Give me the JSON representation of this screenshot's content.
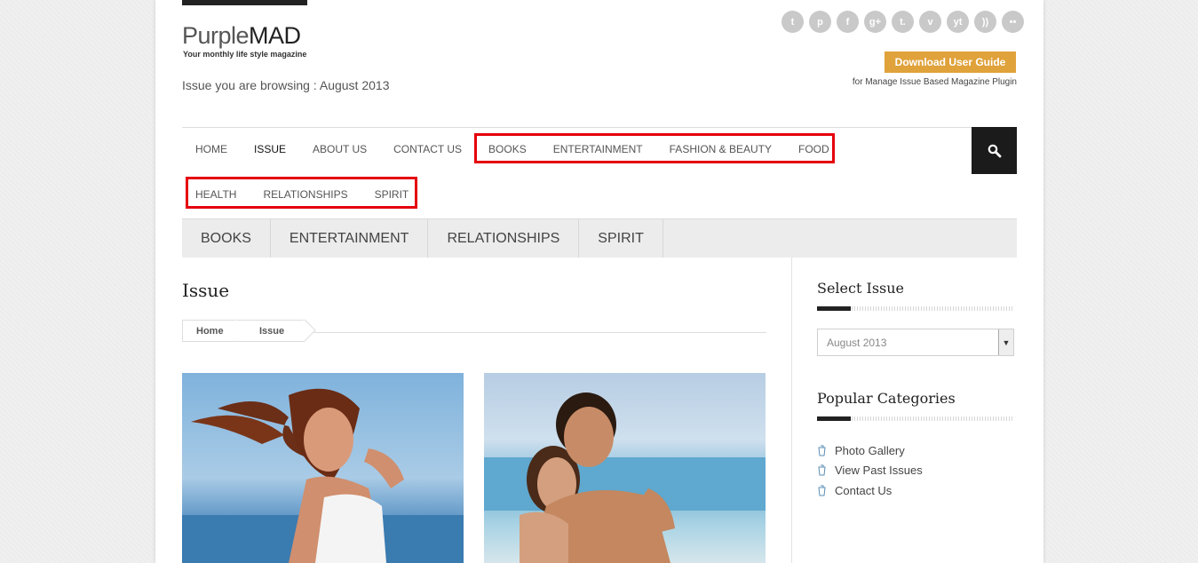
{
  "header": {
    "logo_part1": "Purple",
    "logo_part2": "MAD",
    "tagline": "Your monthly life style magazine",
    "issue_browsing": "Issue you are browsing : August 2013",
    "guide_button": "Download User Guide",
    "guide_note": "for Manage Issue Based Magazine Plugin",
    "social": [
      {
        "icon": "twitter-icon",
        "glyph": "t"
      },
      {
        "icon": "pinterest-icon",
        "glyph": "p"
      },
      {
        "icon": "facebook-icon",
        "glyph": "f"
      },
      {
        "icon": "googleplus-icon",
        "glyph": "g+"
      },
      {
        "icon": "tumblr-icon",
        "glyph": "t."
      },
      {
        "icon": "vimeo-icon",
        "glyph": "v"
      },
      {
        "icon": "youtube-icon",
        "glyph": "yt"
      },
      {
        "icon": "rss-icon",
        "glyph": "))"
      },
      {
        "icon": "flickr-icon",
        "glyph": "••"
      }
    ]
  },
  "nav": {
    "row1": [
      "HOME",
      "ISSUE",
      "ABOUT US",
      "CONTACT US",
      "BOOKS",
      "ENTERTAINMENT",
      "FASHION & BEAUTY",
      "FOOD"
    ],
    "row2": [
      "HEALTH",
      "RELATIONSHIPS",
      "SPIRIT"
    ],
    "active": "ISSUE",
    "search_icon": "search-icon",
    "highlight_color": "#e5000b"
  },
  "category_bar": [
    "BOOKS",
    "ENTERTAINMENT",
    "RELATIONSHIPS",
    "SPIRIT"
  ],
  "main": {
    "title": "Issue",
    "breadcrumb": [
      "Home",
      "Issue"
    ]
  },
  "sidebar": {
    "select_issue_title": "Select Issue",
    "select_value": "August 2013",
    "popular_title": "Popular Categories",
    "popular_items": [
      "Photo Gallery",
      "View Past Issues",
      "Contact Us"
    ]
  },
  "colors": {
    "accent": "#e0a23a",
    "dark": "#1b1b1b"
  }
}
